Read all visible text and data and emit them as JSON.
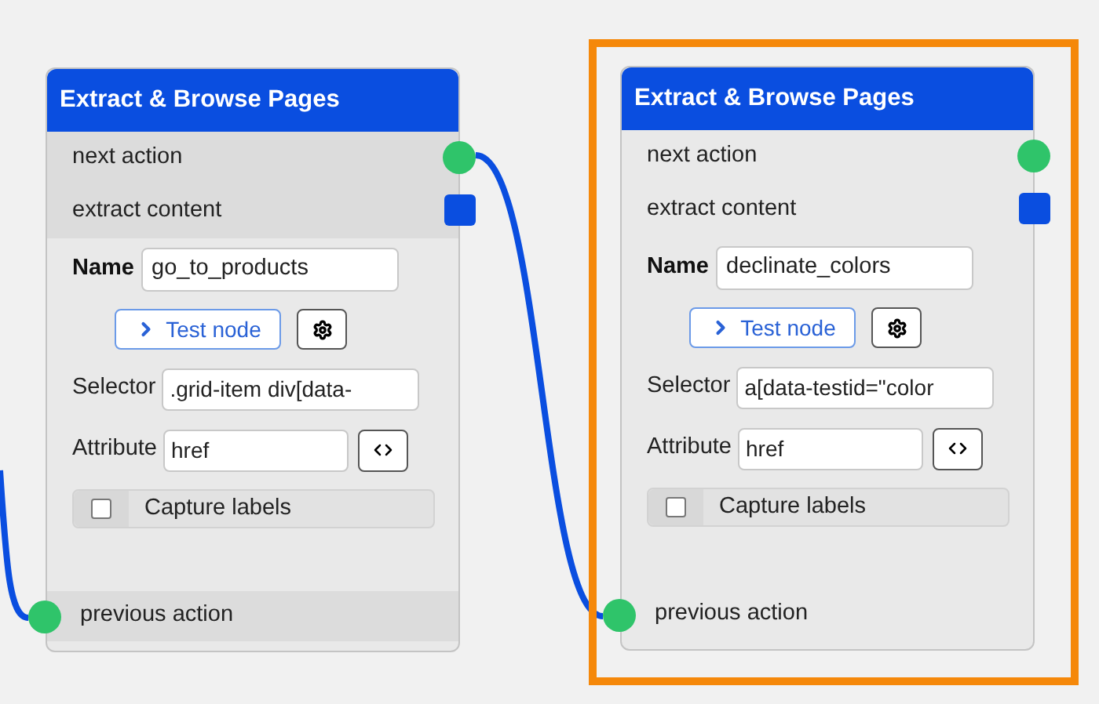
{
  "nodes": [
    {
      "title": "Extract & Browse Pages",
      "selected": false,
      "outputs": [
        {
          "label": "next action",
          "kind": "circle"
        },
        {
          "label": "extract content",
          "kind": "square"
        }
      ],
      "name_label": "Name",
      "name_value": "go_to_products",
      "test_button": "Test node",
      "fields": [
        {
          "label": "Selector",
          "value": ".grid-item div[data-",
          "kind": "text"
        },
        {
          "label": "Attribute",
          "value": "href",
          "kind": "code"
        }
      ],
      "checkbox": {
        "label": "Capture labels",
        "checked": false
      },
      "input": {
        "label": "previous action"
      }
    },
    {
      "title": "Extract & Browse Pages",
      "selected": true,
      "outputs": [
        {
          "label": "next action",
          "kind": "circle"
        },
        {
          "label": "extract content",
          "kind": "square"
        }
      ],
      "name_label": "Name",
      "name_value": "declinate_colors",
      "test_button": "Test node",
      "fields": [
        {
          "label": "Selector",
          "value": "a[data-testid=\"color",
          "kind": "text"
        },
        {
          "label": "Attribute",
          "value": "href",
          "kind": "code"
        }
      ],
      "checkbox": {
        "label": "Capture labels",
        "checked": false
      },
      "input": {
        "label": "previous action"
      }
    }
  ]
}
